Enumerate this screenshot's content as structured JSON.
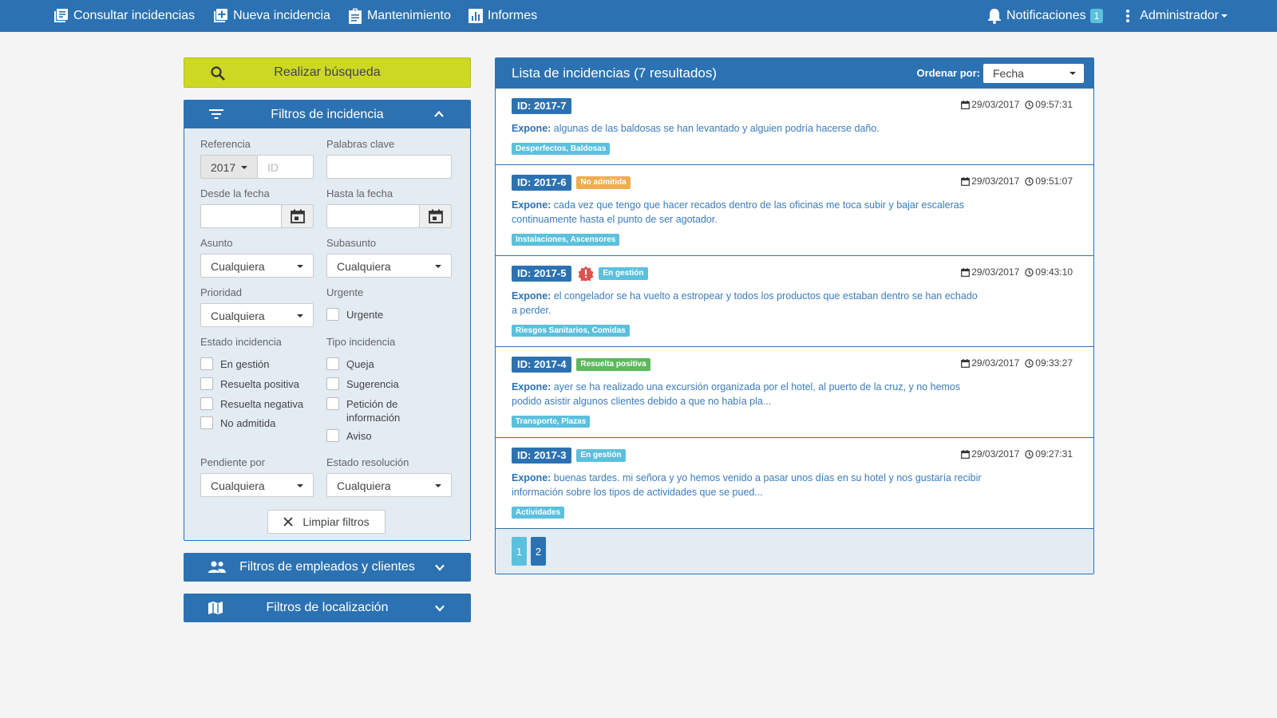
{
  "nav": {
    "items": [
      {
        "label": "Consultar incidencias",
        "icon": "list-icon"
      },
      {
        "label": "Nueva incidencia",
        "icon": "add-box-icon"
      },
      {
        "label": "Mantenimiento",
        "icon": "clipboard-icon"
      },
      {
        "label": "Informes",
        "icon": "bar-chart-icon"
      }
    ],
    "notifications_label": "Notificaciones",
    "notifications_count": "1",
    "user_label": "Administrador"
  },
  "search_button": "Realizar búsqueda",
  "filters": {
    "title": "Filtros de incidencia",
    "referencia_label": "Referencia",
    "year_value": "2017",
    "id_placeholder": "ID",
    "keywords_label": "Palabras clave",
    "desde_label": "Desde la fecha",
    "hasta_label": "Hasta la fecha",
    "asunto_label": "Asunto",
    "asunto_value": "Cualquiera",
    "subasunto_label": "Subasunto",
    "subasunto_value": "Cualquiera",
    "prioridad_label": "Prioridad",
    "prioridad_value": "Cualquiera",
    "urgente_label": "Urgente",
    "urgente_cb": "Urgente",
    "estado_label": "Estado incidencia",
    "estado_options": [
      "En gestión",
      "Resuelta positiva",
      "Resuelta negativa",
      "No admitida"
    ],
    "tipo_label": "Tipo incidencia",
    "tipo_options": [
      "Queja",
      "Sugerencia",
      "Petición de información",
      "Aviso"
    ],
    "pendiente_label": "Pendiente por",
    "pendiente_value": "Cualquiera",
    "resolucion_label": "Estado resolución",
    "resolucion_value": "Cualquiera",
    "clear_label": "Limpiar filtros"
  },
  "empleados_panel": "Filtros de empleados y clientes",
  "localizacion_panel": "Filtros de localización",
  "list": {
    "title": "Lista de incidencias (7 resultados)",
    "sort_label": "Ordenar por:",
    "sort_value": "Fecha",
    "expone_label": "Expone:",
    "items": [
      {
        "id": "ID: 2017-7",
        "status": "",
        "status_color": "",
        "urgent": false,
        "date": "29/03/2017",
        "time": "09:57:31",
        "text": "algunas de las baldosas se han levantado y alguien podría hacerse daño.",
        "category": "Desperfectos, Baldosas"
      },
      {
        "id": "ID: 2017-6",
        "status": "No admitida",
        "status_color": "#f0ad4e",
        "urgent": false,
        "date": "29/03/2017",
        "time": "09:51:07",
        "text": "cada vez que tengo que hacer recados dentro de las oficinas me toca subir y bajar escaleras continuamente hasta el punto de ser agotador.",
        "category": "Instalaciones, Ascensores"
      },
      {
        "id": "ID: 2017-5",
        "status": "En gestión",
        "status_color": "#5bc0de",
        "urgent": true,
        "date": "29/03/2017",
        "time": "09:43:10",
        "text": "el congelador se ha vuelto a estropear y todos los productos que estaban dentro se han echado a perder.",
        "category": "Riesgos Sanitarios, Comidas"
      },
      {
        "id": "ID: 2017-4",
        "status": "Resuelta positiva",
        "status_color": "#5cb85c",
        "urgent": false,
        "date": "29/03/2017",
        "time": "09:33:27",
        "text": "ayer se ha realizado una excursión organizada por el hotel, al puerto de la cruz, y no hemos podido asistir algunos clientes debido a que no había pla...",
        "category": "Transporte, Plazas"
      },
      {
        "id": "ID: 2017-3",
        "status": "En gestión",
        "status_color": "#5bc0de",
        "urgent": false,
        "date": "29/03/2017",
        "time": "09:27:31",
        "text": "buenas tardes. mi señora y yo hemos venido a pasar unos días en su hotel y nos gustaría recibir información sobre los tipos de actividades que se pued...",
        "category": "Actividades"
      }
    ]
  },
  "pagination": {
    "pages": [
      "1",
      "2"
    ],
    "active_color": "#5bc0de",
    "inactive_color": "#2c72b2"
  }
}
